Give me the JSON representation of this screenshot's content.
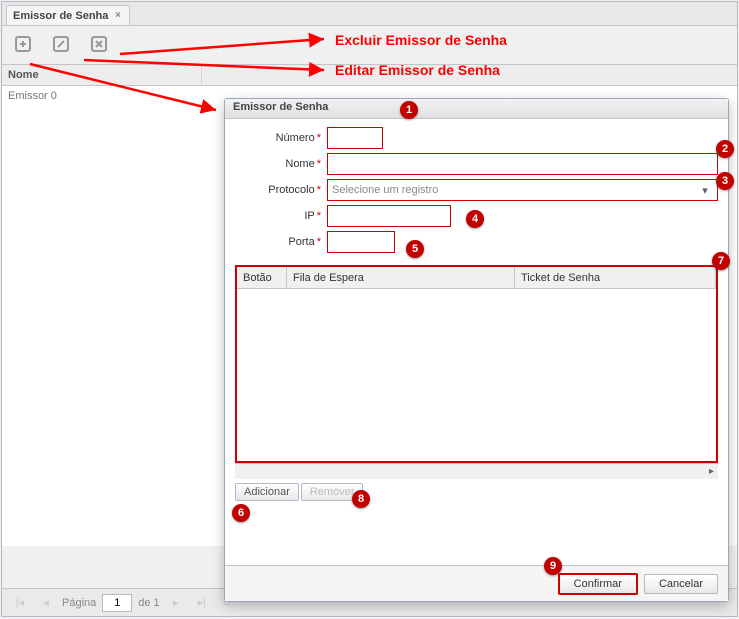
{
  "tab": {
    "title": "Emissor de Senha"
  },
  "toolbar": {
    "add_tooltip": "Adicionar",
    "edit_tooltip": "Editar",
    "delete_tooltip": "Excluir"
  },
  "grid": {
    "columns": [
      "Nome"
    ],
    "rows": [
      {
        "nome": "Emissor 0"
      }
    ]
  },
  "pager": {
    "page_label": "Página",
    "page_value": "1",
    "of_label": "de 1"
  },
  "annotations": {
    "delete_label": "Excluir Emissor de Senha",
    "edit_label": "Editar Emissor de Senha"
  },
  "modal": {
    "title": "Emissor de Senha",
    "fields": {
      "numero": {
        "label": "Número",
        "value": ""
      },
      "nome": {
        "label": "Nome",
        "value": ""
      },
      "protocolo": {
        "label": "Protocolo",
        "placeholder": "Selecione um registro"
      },
      "ip": {
        "label": "IP",
        "value": ""
      },
      "porta": {
        "label": "Porta",
        "value": ""
      }
    },
    "subgrid": {
      "columns": [
        "Botão",
        "Fila de Espera",
        "Ticket de Senha"
      ]
    },
    "sub_toolbar": {
      "add": "Adicionar",
      "remove": "Remover"
    },
    "footer": {
      "confirm": "Confirmar",
      "cancel": "Cancelar"
    }
  },
  "badges": [
    "1",
    "2",
    "3",
    "4",
    "5",
    "6",
    "7",
    "8",
    "9"
  ]
}
